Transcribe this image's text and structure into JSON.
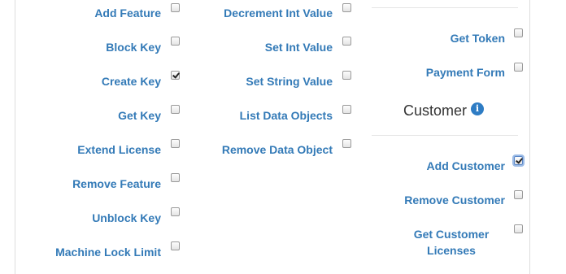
{
  "column1": [
    {
      "label": "Add Feature",
      "checked": false
    },
    {
      "label": "Block Key",
      "checked": false
    },
    {
      "label": "Create Key",
      "checked": true
    },
    {
      "label": "Get Key",
      "checked": false
    },
    {
      "label": "Extend License",
      "checked": false
    },
    {
      "label": "Remove Feature",
      "checked": false
    },
    {
      "label": "Unblock Key",
      "checked": false
    },
    {
      "label": "Machine Lock Limit",
      "checked": false
    }
  ],
  "column2": [
    {
      "label": "Decrement Int Value",
      "checked": false
    },
    {
      "label": "Set Int Value",
      "checked": false
    },
    {
      "label": "Set String Value",
      "checked": false
    },
    {
      "label": "List Data Objects",
      "checked": false
    },
    {
      "label": "Remove Data Object",
      "checked": false
    }
  ],
  "column3_top": [
    {
      "label": "Get Token",
      "checked": false
    },
    {
      "label": "Payment Form",
      "checked": false
    }
  ],
  "customer_section": {
    "title": "Customer",
    "info_icon": "info-circle-icon",
    "items": [
      {
        "label": "Add Customer",
        "checked": true
      },
      {
        "label": "Remove Customer",
        "checked": false
      },
      {
        "label": "Get Customer Licenses",
        "checked": false
      }
    ]
  },
  "colors": {
    "link": "#337ab7",
    "info": "#2e7cc4"
  }
}
